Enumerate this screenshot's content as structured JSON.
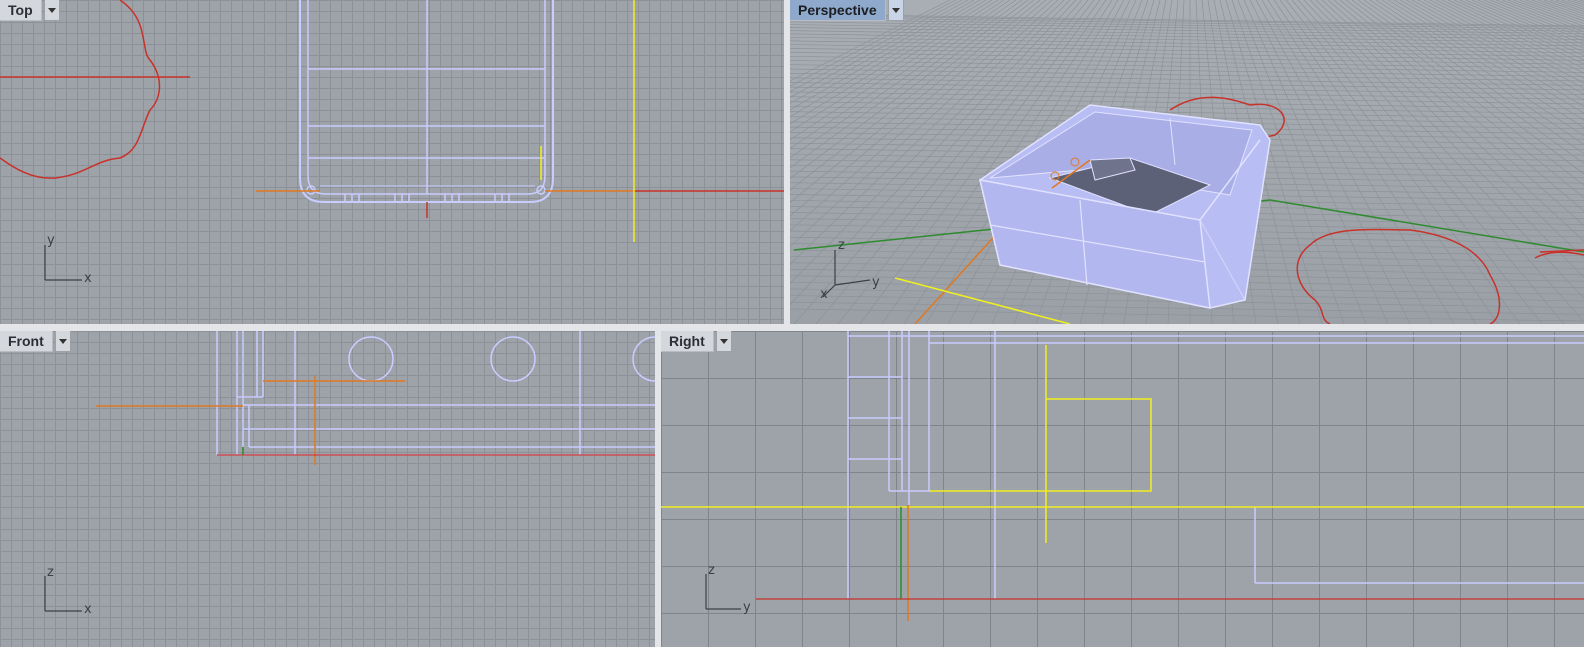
{
  "viewports": {
    "top": {
      "label": "Top",
      "axes": {
        "a": "y",
        "b": "x"
      },
      "active": false
    },
    "perspective": {
      "label": "Perspective",
      "axes": {
        "a": "z",
        "b": "y",
        "c": "x"
      },
      "active": true
    },
    "front": {
      "label": "Front",
      "axes": {
        "a": "z",
        "b": "x"
      },
      "active": false
    },
    "right": {
      "label": "Right",
      "axes": {
        "a": "z",
        "b": "y"
      },
      "active": false
    }
  },
  "icons": {
    "dropdown": "chevron-down-icon",
    "axis_widget": "axis-triad-icon"
  },
  "colors": {
    "viewport_bg": "#9ea3a9",
    "active_label": "#8fa9cc",
    "wireframe": "#c8ccff",
    "x_axis": "#c03030",
    "y_axis": "#2e8b2e",
    "curve_red": "#c8322a",
    "curve_orange": "#e07820",
    "curve_yellow": "#f0f020"
  }
}
